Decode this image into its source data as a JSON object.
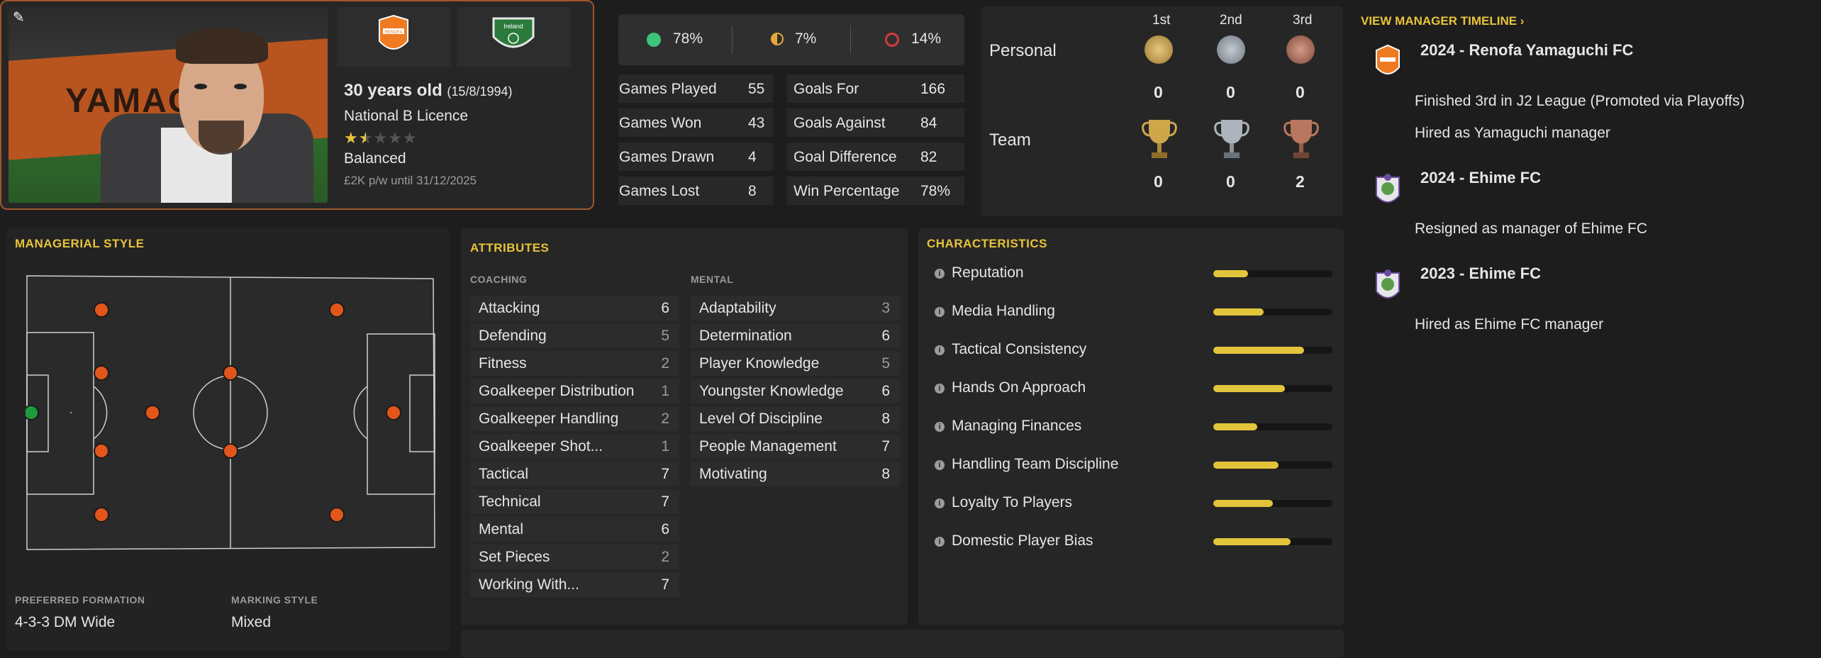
{
  "profile": {
    "age": "30 years old",
    "dob": "(15/8/1994)",
    "licence": "National B Licence",
    "stars_label": "★★☆☆☆",
    "rating_stars": 1.5,
    "rating_max": 5,
    "style": "Balanced",
    "contract": "£2K p/w until 31/12/2025",
    "portrait_sign_text": "YAMAG",
    "club_crest_text": "RENOFA",
    "nation_crest_text": "Ireland"
  },
  "results_pct": {
    "win": "78%",
    "draw": "7%",
    "loss": "14%",
    "win_color": "#3cc47a",
    "draw_color": "#e7a93a",
    "loss_color": "#d33a3a"
  },
  "stats_left": [
    {
      "label": "Games Played",
      "value": "55"
    },
    {
      "label": "Games Won",
      "value": "43"
    },
    {
      "label": "Games Drawn",
      "value": "4"
    },
    {
      "label": "Games Lost",
      "value": "8"
    }
  ],
  "stats_right": [
    {
      "label": "Goals For",
      "value": "166"
    },
    {
      "label": "Goals Against",
      "value": "84"
    },
    {
      "label": "Goal Difference",
      "value": "82"
    },
    {
      "label": "Win Percentage",
      "value": "78%"
    }
  ],
  "honours": {
    "headers": [
      "1st",
      "2nd",
      "3rd"
    ],
    "personal_label": "Personal",
    "personal_counts": [
      "0",
      "0",
      "0"
    ],
    "team_label": "Team",
    "team_counts": [
      "0",
      "0",
      "2"
    ]
  },
  "managerial_style": {
    "title": "MANAGERIAL STYLE",
    "formation_label": "PREFERRED FORMATION",
    "formation_value": "4-3-3 DM Wide",
    "marking_label": "MARKING STYLE",
    "marking_value": "Mixed"
  },
  "attributes": {
    "title": "ATTRIBUTES",
    "coaching_label": "COACHING",
    "mental_label": "MENTAL",
    "coaching": [
      {
        "label": "Attacking",
        "value": "6"
      },
      {
        "label": "Defending",
        "value": "5"
      },
      {
        "label": "Fitness",
        "value": "2"
      },
      {
        "label": "Goalkeeper Distribution",
        "value": "1"
      },
      {
        "label": "Goalkeeper Handling",
        "value": "2"
      },
      {
        "label": "Goalkeeper Shot...",
        "value": "1"
      },
      {
        "label": "Tactical",
        "value": "7"
      },
      {
        "label": "Technical",
        "value": "7"
      },
      {
        "label": "Mental",
        "value": "6"
      },
      {
        "label": "Set Pieces",
        "value": "2"
      },
      {
        "label": "Working With...",
        "value": "7"
      }
    ],
    "mental": [
      {
        "label": "Adaptability",
        "value": "3"
      },
      {
        "label": "Determination",
        "value": "6"
      },
      {
        "label": "Player Knowledge",
        "value": "5"
      },
      {
        "label": "Youngster Knowledge",
        "value": "6"
      },
      {
        "label": "Level Of Discipline",
        "value": "8"
      },
      {
        "label": "People Management",
        "value": "7"
      },
      {
        "label": "Motivating",
        "value": "8"
      }
    ]
  },
  "characteristics": {
    "title": "CHARACTERISTICS",
    "items": [
      {
        "label": "Reputation",
        "level": 0.29
      },
      {
        "label": "Media Handling",
        "level": 0.42
      },
      {
        "label": "Tactical Consistency",
        "level": 0.76
      },
      {
        "label": "Hands On Approach",
        "level": 0.6
      },
      {
        "label": "Managing Finances",
        "level": 0.37
      },
      {
        "label": "Handling Team Discipline",
        "level": 0.55
      },
      {
        "label": "Loyalty To Players",
        "level": 0.5
      },
      {
        "label": "Domestic Player Bias",
        "level": 0.65
      }
    ]
  },
  "timeline": {
    "link_label": "VIEW MANAGER TIMELINE",
    "entries": [
      {
        "title": "2024 - Renofa Yamaguchi FC",
        "events": [
          "Finished 3rd in J2 League (Promoted via Playoffs)",
          "Hired as Yamaguchi manager"
        ],
        "crest": "renofa-crest-icon"
      },
      {
        "title": "2024 - Ehime FC",
        "events": [
          "Resigned as manager of Ehime FC"
        ],
        "crest": "ehime-crest-icon"
      },
      {
        "title": "2023 - Ehime FC",
        "events": [
          "Hired as Ehime FC manager"
        ],
        "crest": "ehime-crest-icon"
      }
    ]
  },
  "colors": {
    "accent": "#e8c33a",
    "card_border": "#a0562d",
    "player_dot": "#e2561b",
    "keeper_dot": "#1f9a3c"
  }
}
